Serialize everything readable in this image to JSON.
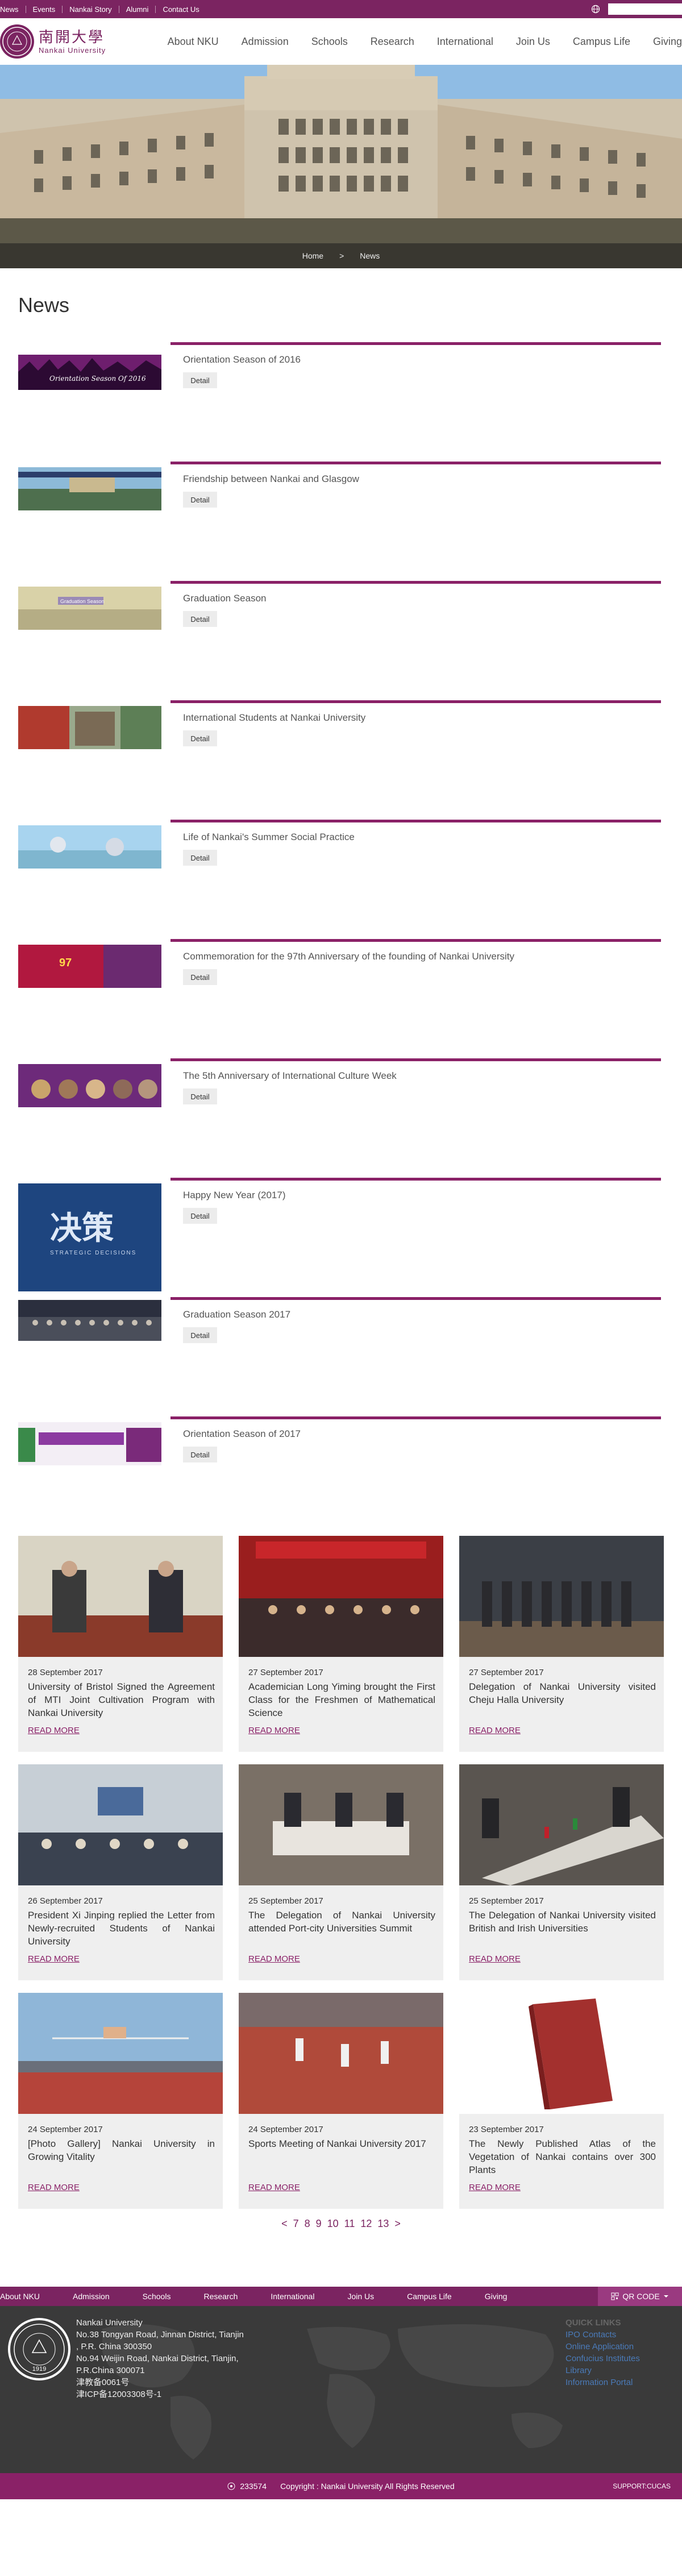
{
  "topbar": {
    "links": [
      "News",
      "Events",
      "Nankai Story",
      "Alumni",
      "Contact Us"
    ],
    "search_placeholder": ""
  },
  "header": {
    "logo_cn": "南開大學",
    "logo_en": "Nankai University",
    "nav": [
      "About NKU",
      "Admission",
      "Schools",
      "Research",
      "International",
      "Join Us",
      "Campus Life",
      "Giving"
    ]
  },
  "breadcrumb": {
    "home": "Home",
    "sep": ">",
    "current": "News"
  },
  "page_title": "News",
  "detail_label": "Detail",
  "news": [
    {
      "title": "Orientation Season of 2016",
      "thumb_text": "Orientation Season Of 2016"
    },
    {
      "title": "Friendship between Nankai and Glasgow",
      "thumb_text": ""
    },
    {
      "title": "Graduation Season",
      "thumb_text": "Graduation Season"
    },
    {
      "title": "International Students at Nankai University",
      "thumb_text": ""
    },
    {
      "title": "Life of Nankai's Summer Social Practice",
      "thumb_text": ""
    },
    {
      "title": "Commemoration for the 97th Anniversary of the founding of Nankai University",
      "thumb_text": "97"
    },
    {
      "title": "The 5th Anniversary of International Culture Week",
      "thumb_text": ""
    },
    {
      "title": "Happy New Year (2017)",
      "thumb_text": "决策",
      "thumb_sub": "STRATEGIC DECISIONS"
    },
    {
      "title": "Graduation Season 2017",
      "thumb_text": ""
    },
    {
      "title": "Orientation Season of 2017",
      "thumb_text": ""
    }
  ],
  "read_more_label": "READ MORE",
  "cards": [
    {
      "date": "28 September 2017",
      "title": "University of Bristol Signed the Agreement of MTI Joint Cultivation Program with Nankai University"
    },
    {
      "date": "27 September 2017",
      "title": "Academician Long Yiming brought the First Class for the Freshmen of Mathematical Science"
    },
    {
      "date": "27 September 2017",
      "title": "Delegation of Nankai University visited Cheju Halla University"
    },
    {
      "date": "26 September 2017",
      "title": "President Xi Jinping replied the Letter from Newly-recruited Students of Nankai University"
    },
    {
      "date": "25 September 2017",
      "title": "The Delegation of Nankai University attended Port-city Universities Summit"
    },
    {
      "date": "25 September 2017",
      "title": "The Delegation of Nankai University visited British and Irish Universities"
    },
    {
      "date": "24 September 2017",
      "title": "[Photo Gallery] Nankai University in Growing Vitality"
    },
    {
      "date": "24 September 2017",
      "title": "Sports Meeting of Nankai University 2017"
    },
    {
      "date": "23 September 2017",
      "title": "The Newly Published Atlas of the Vegetation of Nankai contains over 300 Plants"
    }
  ],
  "pagination": [
    "<",
    "7",
    "8",
    "9",
    "10",
    "11",
    "12",
    "13",
    ">"
  ],
  "bottom_nav": [
    "About NKU",
    "Admission",
    "Schools",
    "Research",
    "International",
    "Join Us",
    "Campus Life",
    "Giving"
  ],
  "qr_label": "QR CODE",
  "footer": {
    "address": [
      "Nankai University",
      "No.38 Tongyan Road, Jinnan District, Tianjin",
      ", P.R. China 300350",
      "No.94 Weijin Road,  Nankai District, Tianjin,",
      "P.R.China 300071",
      "津教备0061号",
      "津ICP备12003308号-1"
    ],
    "seal_year": "1919",
    "links_heading": "QUICK LINKS",
    "links": [
      "IPO Contacts",
      "Online Application",
      "Confucius Institutes",
      "Library",
      "Information Portal"
    ]
  },
  "copyright": {
    "counter": "233574",
    "text": "Copyright : Nankai University All Rights Reserved",
    "support": "SUPPORT:CUCAS"
  },
  "colors": {
    "brand": "#7b2461",
    "accent": "#8a2167"
  }
}
